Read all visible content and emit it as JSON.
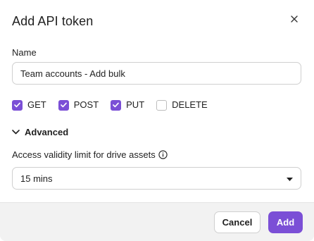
{
  "dialog": {
    "title": "Add API token",
    "close_icon": "close-icon"
  },
  "name_field": {
    "label": "Name",
    "value": "Team accounts - Add bulk"
  },
  "methods": [
    {
      "label": "GET",
      "checked": true
    },
    {
      "label": "POST",
      "checked": true
    },
    {
      "label": "PUT",
      "checked": true
    },
    {
      "label": "DELETE",
      "checked": false
    }
  ],
  "advanced": {
    "label": "Advanced",
    "icon": "chevron-down-icon",
    "expanded": true
  },
  "validity": {
    "label": "Access validity limit for drive assets",
    "info_icon": "info-icon",
    "selected": "15 mins",
    "dropdown_icon": "caret-down-icon"
  },
  "footer": {
    "cancel_label": "Cancel",
    "add_label": "Add"
  },
  "colors": {
    "accent": "#7b4fd6",
    "text": "#1f1f1f",
    "border": "#cfcfcf",
    "footer_bg": "#f2f2f2"
  }
}
